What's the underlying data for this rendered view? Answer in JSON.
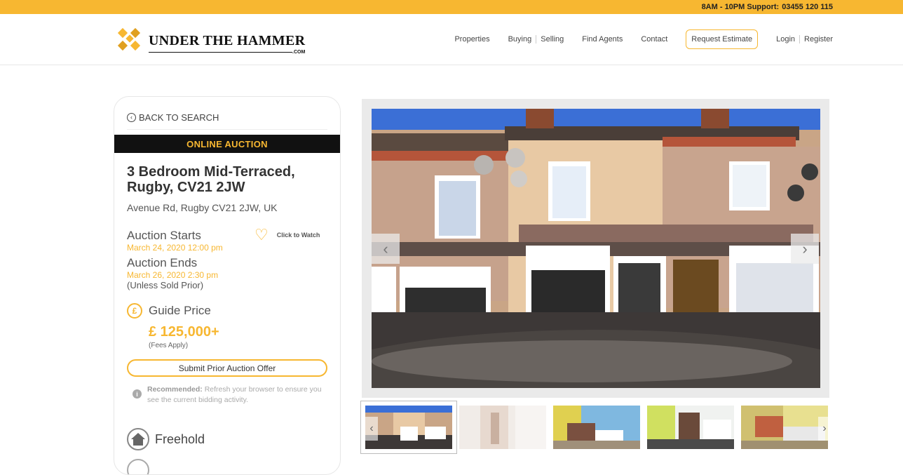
{
  "topbar": {
    "hours": "8AM - 10PM Support:",
    "phone": "03455 120 115"
  },
  "logo": {
    "name": "UNDER THE HAMMER",
    "suffix": ".COM"
  },
  "nav": {
    "properties": "Properties",
    "buying": "Buying",
    "selling": "Selling",
    "find_agents": "Find Agents",
    "contact": "Contact",
    "estimate": "Request Estimate",
    "login": "Login",
    "register": "Register"
  },
  "sidebar": {
    "back": "BACK TO SEARCH",
    "auction_type": "ONLINE AUCTION",
    "title": "3 Bedroom Mid-Terraced, Rugby, CV21 2JW",
    "address": "Avenue Rd, Rugby CV21 2JW, UK",
    "starts_label": "Auction Starts",
    "starts_date": "March 24, 2020 12:00 pm",
    "ends_label": "Auction Ends",
    "ends_date": "March 26, 2020 2:30 pm",
    "unless": "(Unless Sold Prior)",
    "watch": "Click to Watch",
    "guide_label": "Guide Price",
    "price": "£ 125,000+",
    "fees": "(Fees Apply)",
    "offer_button": "Submit Prior Auction Offer",
    "recommended_label": "Recommended:",
    "recommended_text": "Refresh your browser to ensure you see the current bidding activity.",
    "tenure": "Freehold"
  },
  "colors": {
    "accent": "#f7b731",
    "dark": "#111111"
  },
  "icons": {
    "back": "chevron-left-circle-icon",
    "watch": "heart-icon",
    "guide": "pound-icon",
    "info": "info-icon",
    "tenure": "house-icon",
    "prev": "chevron-left-icon",
    "next": "chevron-right-icon"
  }
}
